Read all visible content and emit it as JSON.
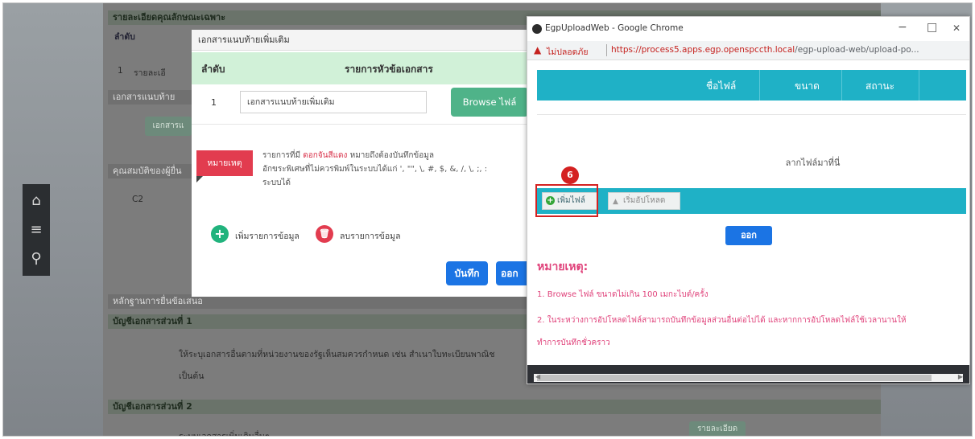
{
  "background": {
    "section_header": "รายละเอียดคุณลักษณะเฉพาะ",
    "col_order": "ลำดับ",
    "row1_num": "1",
    "row1_text": "รายละเอี",
    "attach_section": "เอกสารแนบท้าย",
    "attach_btn": "เอกสารแ",
    "qual_section": "คุณสมบัติของผู้ยื่น",
    "qual_code": "C2",
    "evidence_section": "หลักฐานการยื่นข้อเสนอ",
    "doc_part1": "บัญชีเอกสารส่วนที่ 1",
    "doc_part1_text": "ให้ระบุเอกสารอื่นตามที่หน่วยงานของรัฐเห็นสมควรกำหนด เช่น สำเนาใบทะเบียนพาณิช",
    "doc_part1_text2": "เป็นต้น",
    "doc_part2": "บัญชีเอกสารส่วนที่ 2",
    "doc_part2_text": "ระบบเอกสารเพิ่มเติมอื่นๆ",
    "detail_btn": "รายละเอียด"
  },
  "nav": {
    "home_icon": "home-icon",
    "menu_icon": "menu-icon",
    "search_icon": "search-icon"
  },
  "attach_modal": {
    "title": "เอกสารแนบท้ายเพิ่มเติม",
    "col_order": "ลำดับ",
    "col_list": "รายการหัวข้อเอกสาร",
    "row_num": "1",
    "row_value": "เอกสารแนบท้ายเพิ่มเติม",
    "browse_label": "Browse ไฟล์",
    "note_badge": "หมายเหตุ",
    "note_line1_pre": "รายการที่มี ",
    "note_line1_red": "ดอกจันสีแดง",
    "note_line1_post": " หมายถึงต้องบันทึกข้อมูล",
    "note_line2": "อักขระพิเศษที่ไม่ควรพิมพ์ในระบบได้แก่ ', \"\", \\, #, $, &, /, \\, ;, :",
    "note_line3": "ระบบได้",
    "add_label": "เพิ่มรายการข้อมูล",
    "delete_label": "ลบรายการข้อมูล",
    "save_label": "บันทึก",
    "exit_label": "ออก"
  },
  "chrome": {
    "window_title": "EgpUploadWeb - Google Chrome",
    "not_secure": "ไม่ปลอดภัย",
    "url_domain": "https://process5.apps.egp.openspccth.local",
    "url_path": "/egp-upload-web/upload-po...",
    "col_filename": "ชื่อไฟล์",
    "col_size": "ขนาด",
    "col_status": "สถานะ",
    "drop_text": "ลากไฟล์มาที่นี่",
    "add_file": "เพิ่มไฟล์",
    "start_upload": "เริ่มอัปโหลด",
    "exit_label": "ออก",
    "note_heading": "หมายเหตุ:",
    "note1": "1. Browse ไฟล์ ขนาดไม่เกิน 100 เมกะไบต์/ครั้ง",
    "note2": "2. ในระหว่างการอัปโหลดไฟล์สามารถบันทึกข้อมูลส่วนอื่นต่อไปได้ และหากการอัปโหลดไฟล์ใช้เวลานานให้",
    "note3": "ทำการบันทึกชั่วคราว",
    "step_number": "6",
    "minimize": "−",
    "maximize": "□",
    "close": "✕"
  }
}
